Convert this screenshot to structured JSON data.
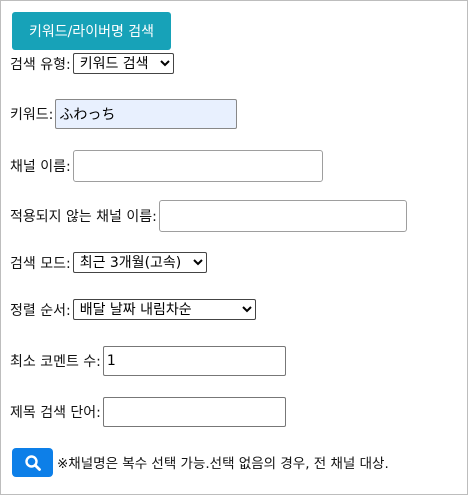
{
  "tab_button": "키워드/라이버명 검색",
  "search_type": {
    "label": "검색 유형:",
    "value": "키워드 검색"
  },
  "keyword": {
    "label": "키워드:",
    "value": "ふわっち"
  },
  "channel_name": {
    "label": "채널 이름:",
    "value": ""
  },
  "excluded_channel": {
    "label": "적용되지 않는 채널 이름:",
    "value": ""
  },
  "search_mode": {
    "label": "검색 모드:",
    "value": "최근 3개월(고속)"
  },
  "sort_order": {
    "label": "정렬 순서:",
    "value": "배달 날짜 내림차순"
  },
  "min_comments": {
    "label": "최소 코멘트 수:",
    "value": "1"
  },
  "title_keyword": {
    "label": "제목 검색 단어:",
    "value": ""
  },
  "search_icon": "search-icon",
  "note": "※채널명은 복수 선택 가능.선택 없음의 경우, 전 채널 대상."
}
